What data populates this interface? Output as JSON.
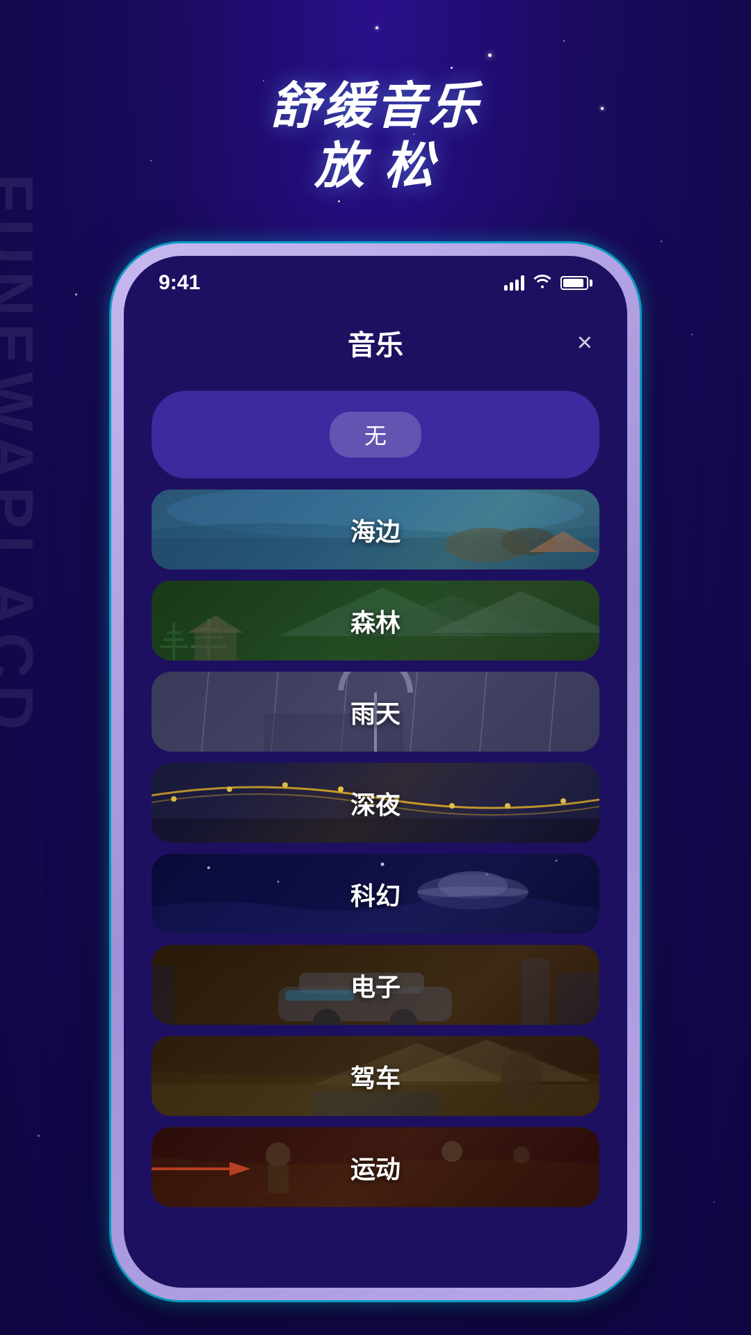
{
  "background": {
    "side_text": "FUNEWAPLACD"
  },
  "header": {
    "line1": "舒缓音乐",
    "line2": "放  松"
  },
  "status_bar": {
    "time": "9:41",
    "signal": "signal",
    "wifi": "wifi",
    "battery": "battery"
  },
  "app": {
    "title": "音乐",
    "close_label": "×"
  },
  "music_items": [
    {
      "id": "none",
      "label": "无",
      "type": "none"
    },
    {
      "id": "beach",
      "label": "海边",
      "type": "beach"
    },
    {
      "id": "forest",
      "label": "森林",
      "type": "forest"
    },
    {
      "id": "rain",
      "label": "雨天",
      "type": "rain"
    },
    {
      "id": "night",
      "label": "深夜",
      "type": "night"
    },
    {
      "id": "scifi",
      "label": "科幻",
      "type": "scifi"
    },
    {
      "id": "electronic",
      "label": "电子",
      "type": "electronic"
    },
    {
      "id": "driving",
      "label": "驾车",
      "type": "driving"
    },
    {
      "id": "sport",
      "label": "运动",
      "type": "sport"
    }
  ]
}
